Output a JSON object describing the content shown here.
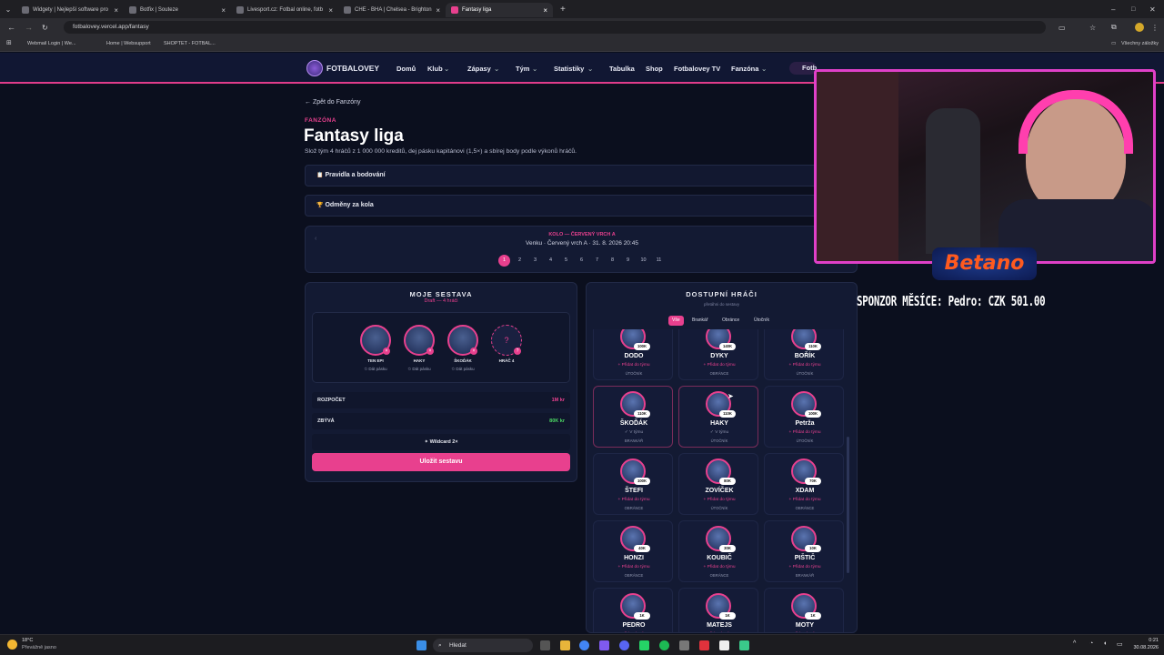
{
  "browser": {
    "tabs": [
      {
        "title": "Widgety | Nejlepší software pro"
      },
      {
        "title": "Botfix | Souteze"
      },
      {
        "title": "Livesport.cz: Fotbal online, fotb"
      },
      {
        "title": "CHE - BHA | Chelsea - Brighton"
      },
      {
        "title": "Fantasy liga"
      }
    ],
    "new_tab": "+",
    "url": "fotbalovey.vercel.app/fantasy",
    "bookmarks": [
      "Webmail Login | We...",
      "Home | Websupport",
      "SHOPTET - FOTBAL..."
    ],
    "all_bookmarks": "Všechny záložky"
  },
  "site": {
    "logo": "FOTBALOVEY",
    "nav": [
      "Domů",
      "Klub",
      "Zápasy",
      "Tým",
      "Statistiky",
      "Tabulka",
      "Shop",
      "Fotbalovey TV",
      "Fanzóna"
    ],
    "nav_dropdown": [
      false,
      true,
      true,
      true,
      true,
      false,
      false,
      false,
      true
    ],
    "user_badge": "Fotbalovey"
  },
  "page": {
    "back_link": "Zpět do Fanzóny",
    "section_label": "FANZÓNA",
    "title": "Fantasy liga",
    "subtitle": "Slož tým 4 hráčů z 1 000 000 kreditů, dej pásku kapitánovi (1,5×) a sbírej body podle výkonů hráčů.",
    "accordions": [
      {
        "icon": "📋",
        "label": "Pravidla a bodování"
      },
      {
        "icon": "🏆",
        "label": "Odměny za kola"
      }
    ],
    "round": {
      "label": "KOLO — ČERVENÝ VRCH A",
      "match": "Venku · Červený vrch A · 31. 8. 2026 20:45",
      "numbers": [
        "1",
        "2",
        "3",
        "4",
        "5",
        "6",
        "7",
        "8",
        "9",
        "10",
        "11"
      ],
      "active": "1"
    }
  },
  "lineup": {
    "title": "MOJE SESTAVA",
    "status": "Draft — 4 hráči",
    "slots": [
      {
        "name": "TEN EPI",
        "captain": "✩ Dát pásku"
      },
      {
        "name": "HAKY",
        "captain": "✩ Dát pásku"
      },
      {
        "name": "ŠKOĎÁK",
        "captain": "✩ Dát pásku"
      },
      {
        "name": "HRÁČ 4",
        "captain": ""
      }
    ],
    "empty_mark": "?",
    "budget_label": "ROZPOČET",
    "budget_value": "1M kr",
    "remaining_label": "ZBÝVÁ",
    "remaining_value": "80K kr",
    "wildcard": "✦ Wildcard 2×",
    "save": "Uložit sestavu"
  },
  "available": {
    "title": "DOSTUPNÍ HRÁČI",
    "subtitle": "přetáhni do sestavy",
    "filters": [
      "Vše",
      "Brankář",
      "Obránce",
      "Útočník"
    ],
    "active_filter": "Vše",
    "players": [
      {
        "name": "DODO",
        "price": "100K",
        "action": "+ Přidat do týmu",
        "pos": "ÚTOČNÍK",
        "in_team": false
      },
      {
        "name": "DYKY",
        "price": "140K",
        "action": "+ Přidat do týmu",
        "pos": "OBRÁNCE",
        "in_team": false
      },
      {
        "name": "BOŘÍK",
        "price": "110K",
        "action": "+ Přidat do týmu",
        "pos": "ÚTOČNÍK",
        "in_team": false
      },
      {
        "name": "ŠKOĎÁK",
        "price": "110K",
        "action": "✓ V týmu",
        "pos": "BRANKÁŘ",
        "in_team": true
      },
      {
        "name": "HAKY",
        "price": "110K",
        "action": "✓ V týmu",
        "pos": "ÚTOČNÍK",
        "in_team": true
      },
      {
        "name": "Petrža",
        "price": "100K",
        "action": "+ Přidat do týmu",
        "pos": "ÚTOČNÍK",
        "in_team": false
      },
      {
        "name": "ŠTEFI",
        "price": "100K",
        "action": "+ Přidat do týmu",
        "pos": "OBRÁNCE",
        "in_team": false
      },
      {
        "name": "ZOVÍČEK",
        "price": "80K",
        "action": "+ Přidat do týmu",
        "pos": "ÚTOČNÍK",
        "in_team": false
      },
      {
        "name": "XDAM",
        "price": "70K",
        "action": "+ Přidat do týmu",
        "pos": "OBRÁNCE",
        "in_team": false
      },
      {
        "name": "HONZI",
        "price": "40K",
        "action": "+ Přidat do týmu",
        "pos": "OBRÁNCE",
        "in_team": false
      },
      {
        "name": "KOUBIČ",
        "price": "30K",
        "action": "+ Přidat do týmu",
        "pos": "OBRÁNCE",
        "in_team": false
      },
      {
        "name": "PIŠTIČ",
        "price": "10K",
        "action": "+ Přidat do týmu",
        "pos": "BRANKÁŘ",
        "in_team": false
      },
      {
        "name": "PEDRO",
        "price": "1K",
        "action": "+ Přidat do týmu",
        "pos": "",
        "in_team": false
      },
      {
        "name": "MATEJS",
        "price": "1K",
        "action": "+ Přidat do týmu",
        "pos": "",
        "in_team": false
      },
      {
        "name": "MOTY",
        "price": "1K",
        "action": "+ Přidat do týmu",
        "pos": "",
        "in_team": false
      }
    ]
  },
  "overlay": {
    "sponsor_logo": "Betano",
    "sponsor_text": "SPONZOR MĚSÍCE: Pedro: CZK 501.00"
  },
  "taskbar": {
    "weather_temp": "18°C",
    "weather_desc": "Převážně jasno",
    "search": "Hledat",
    "time": "0:21",
    "date": "30.08.2026"
  },
  "colors": {
    "accent": "#e8408e",
    "bg": "#0b0f1e",
    "panel": "#131a33",
    "green": "#4cd964"
  }
}
